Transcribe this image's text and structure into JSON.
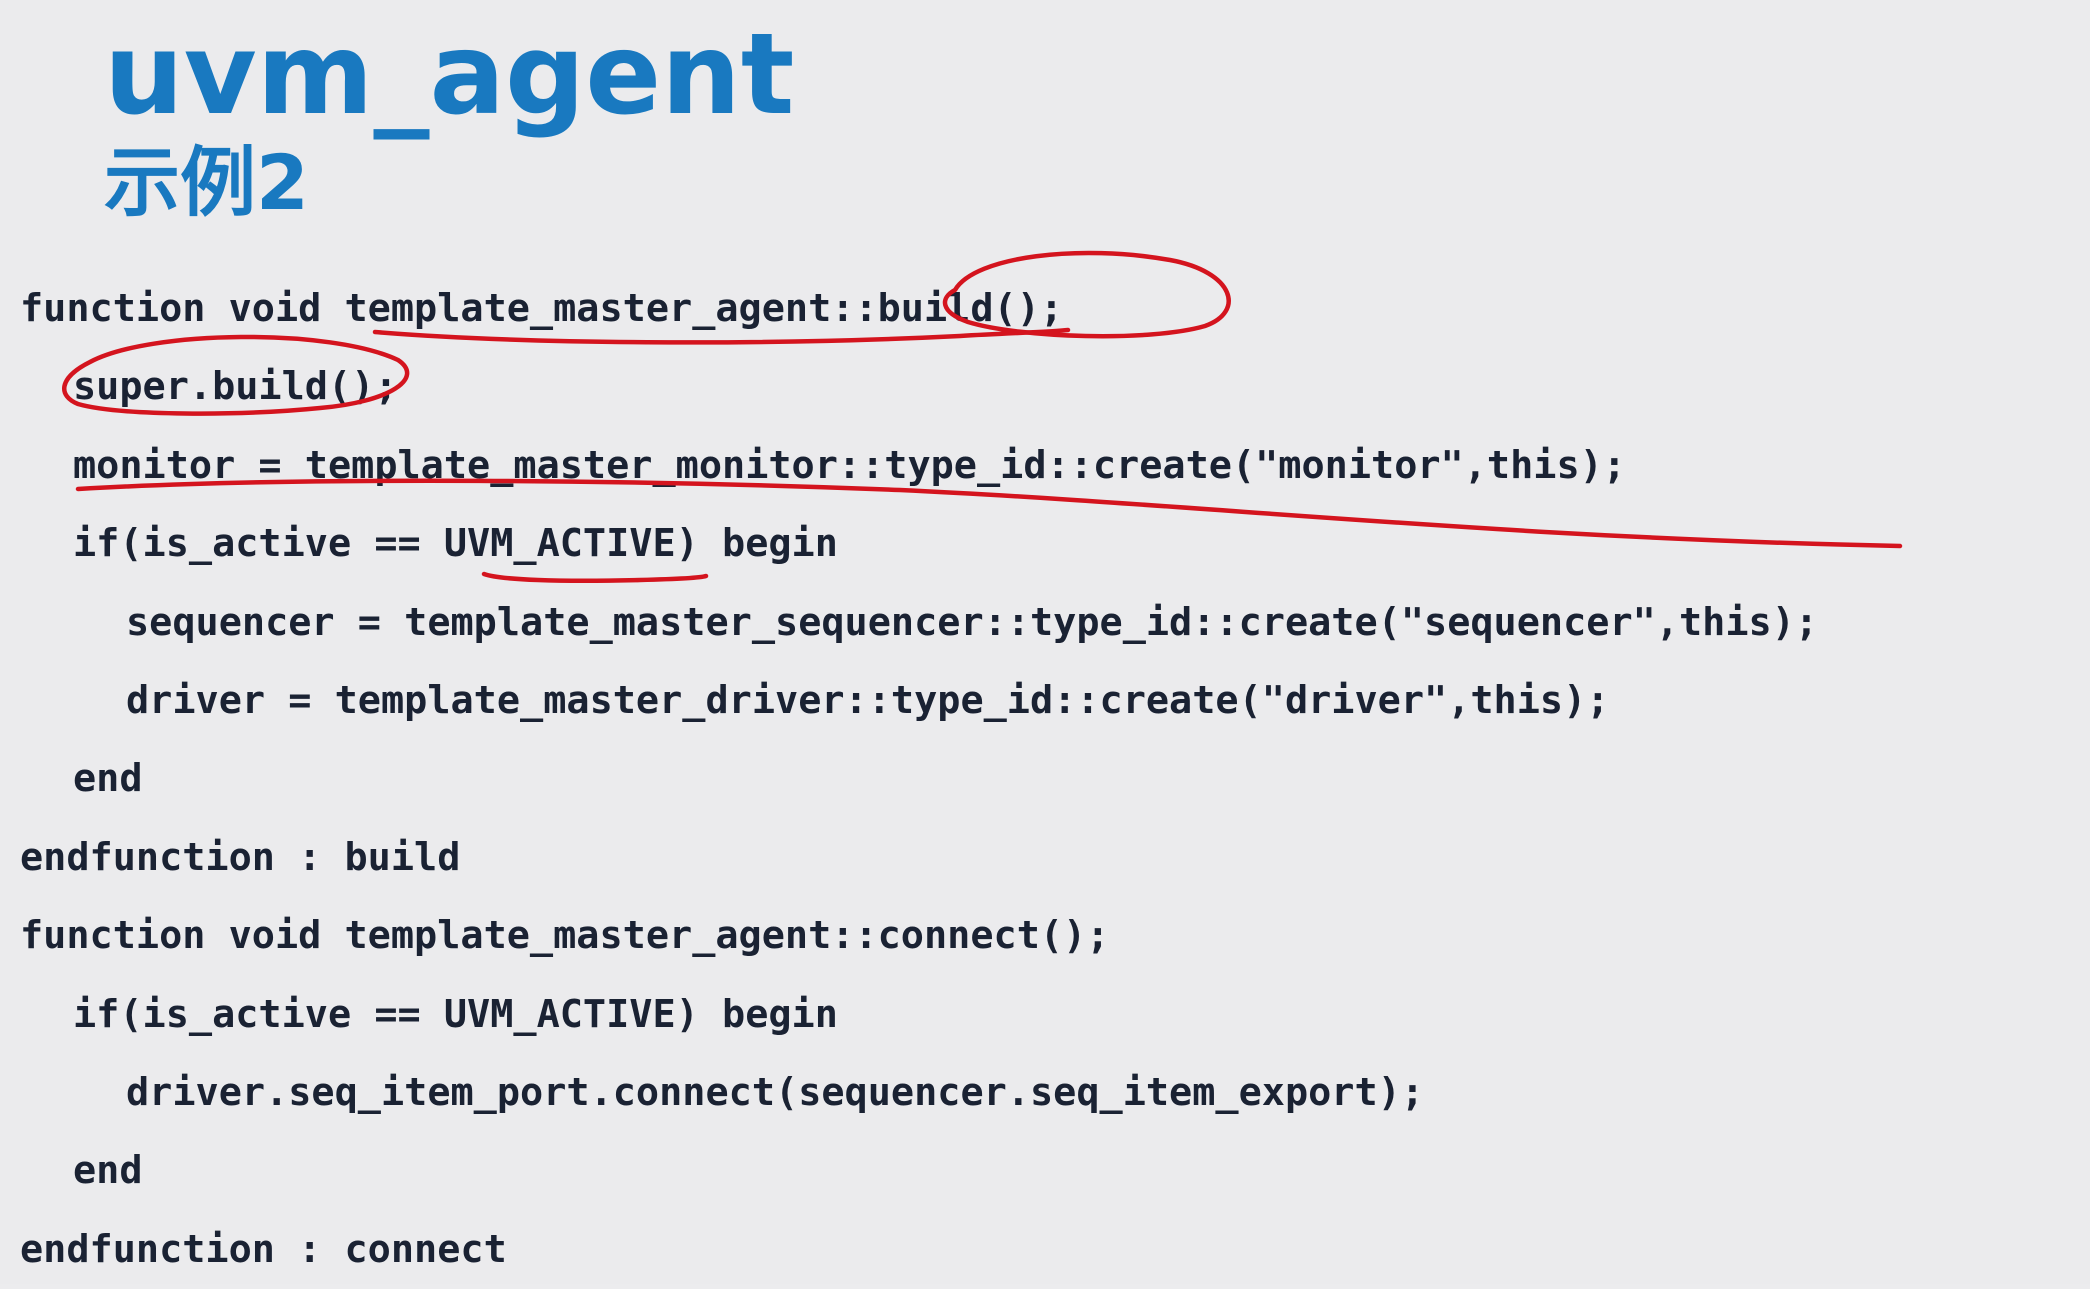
{
  "slide": {
    "title": "uvm_agent",
    "subtitle": "示例2"
  },
  "code": {
    "lines": [
      "function void template_master_agent::build();",
      "super.build();",
      "monitor = template_master_monitor::type_id::create(\"monitor\",this);",
      "if(is_active == UVM_ACTIVE) begin",
      "sequencer = template_master_sequencer::type_id::create(\"sequencer\",this);",
      "driver = template_master_driver::type_id::create(\"driver\",this);",
      "end",
      "endfunction : build",
      "function void template_master_agent::connect();",
      "if(is_active == UVM_ACTIVE) begin",
      "driver.seq_item_port.connect(sequencer.seq_item_export);",
      "end",
      "endfunction : connect"
    ]
  },
  "colors": {
    "background": "#ebebed",
    "title": "#1979c0",
    "code_text": "#1a2233",
    "annotation_ink": "#d4141e"
  }
}
